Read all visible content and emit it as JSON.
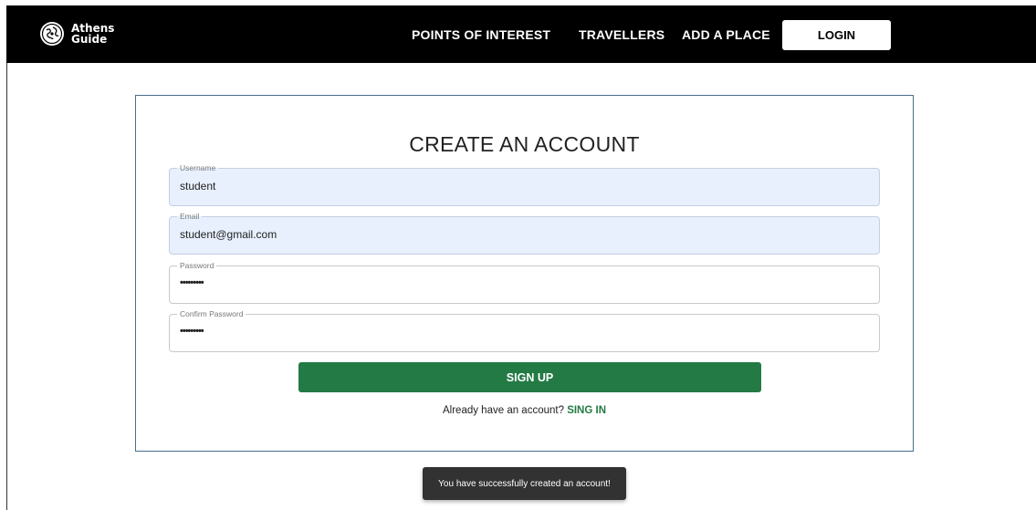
{
  "colors": {
    "navbar_bg": "#000000",
    "primary_green": "#237a45",
    "autofill_bg": "#e8f0fe",
    "card_border": "#4a6e8a",
    "toast_bg": "#323232"
  },
  "brand": {
    "icon": "athens-globe-logo-icon",
    "name": "Athens\nGuide"
  },
  "nav": {
    "points_of_interest": "POINTS OF INTEREST",
    "travellers": "TRAVELLERS",
    "add_a_place": "ADD A PLACE",
    "login": "LOGIN"
  },
  "form": {
    "title": "CREATE AN ACCOUNT",
    "username": {
      "label": "Username",
      "value": "student"
    },
    "email": {
      "label": "Email",
      "value": "student@gmail.com"
    },
    "password": {
      "label": "Password",
      "value": "•••••••••"
    },
    "confirm_password": {
      "label": "Confirm Password",
      "value": "•••••••••"
    },
    "submit": "SIGN UP",
    "signin_prompt": "Already have an account?",
    "signin_link": "SING IN"
  },
  "toast": {
    "message": "You have successfully created an account!"
  }
}
